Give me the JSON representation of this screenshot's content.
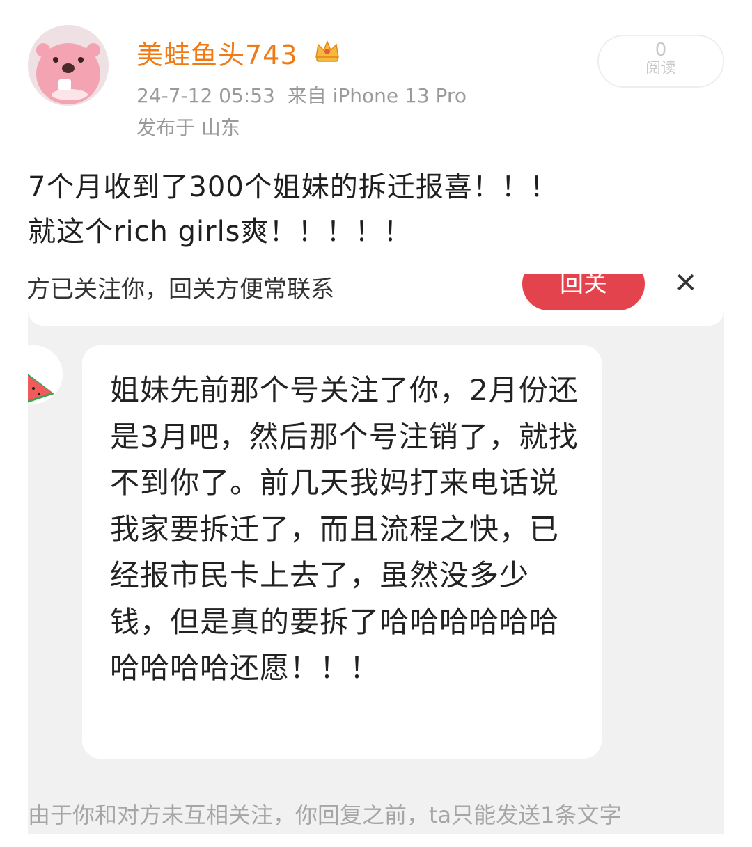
{
  "post": {
    "username": "美蛙鱼头743",
    "timestamp": "24-7-12 05:53",
    "source": "来自 iPhone 13 Pro",
    "location": "发布于 山东",
    "read_count": "0",
    "read_label": "阅读",
    "text_line1": "7个月收到了300个姐妹的拆迁报喜！！！",
    "text_line2": "就这个rich girls爽！！！！！",
    "icons": {
      "avatar": "pink-beaver-avatar",
      "badge": "crown-icon"
    },
    "accent_color": "#f07a16"
  },
  "chat_screenshot": {
    "cut_notice": "方已关注你，回关方便常联系",
    "follow_back_label": "回关",
    "close_icon": "close-icon",
    "message": "姐妹先前那个号关注了你，2月份还是3月吧，然后那个号注销了，就找不到你了。前几天我妈打来电话说我家要拆迁了，而且流程之快，已经报市民卡上去了，虽然没多少钱，但是真的要拆了哈哈哈哈哈哈哈哈哈哈还愿！！！",
    "bottom_note": "由于你和对方未互相关注，你回复之前，ta只能发送1条文字",
    "button_color": "#e3434c"
  }
}
